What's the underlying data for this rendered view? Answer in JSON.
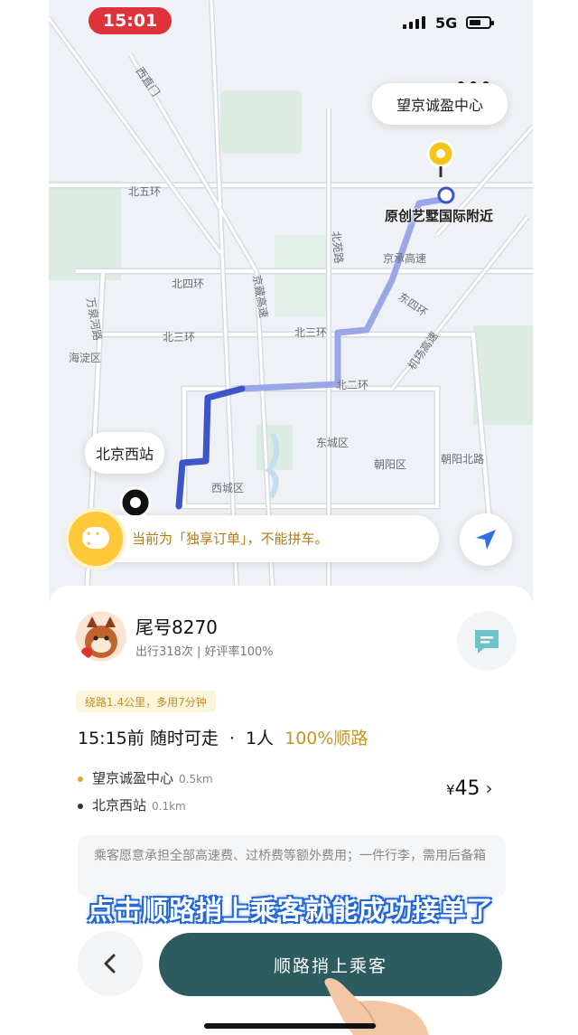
{
  "status_bar": {
    "time": "15:01",
    "network": "5G",
    "more": "•••"
  },
  "map": {
    "destination_label": "望京诚盈中心",
    "destination_sublabel": "原创艺墅国际附近",
    "origin_label": "北京西站",
    "road_labels": [
      "北五环",
      "北四环",
      "北三环",
      "北三环",
      "北二环",
      "东城区",
      "西城区",
      "朝阳区",
      "朝阳北路",
      "海淀区",
      "京藏高速",
      "万泉河路",
      "北苑路",
      "京承高速",
      "机场高速",
      "东四环",
      "西直门"
    ],
    "route_color": "#3d55c8"
  },
  "notice": {
    "text": "当前为「独享订单」，不能拼车。"
  },
  "icons": {
    "locate": "navigation-arrow-icon",
    "chat": "message-icon",
    "back": "chevron-left-icon",
    "notice": "chat-bubble-icon",
    "destination_pin": "yellow-pin-icon",
    "origin_pin": "black-pin-icon"
  },
  "driver": {
    "name": "尾号8270",
    "stats": "出行318次 | 好评率100%"
  },
  "trip": {
    "route_tag": "绕路1.4公里，多用7分钟",
    "depart": "15:15前",
    "availability": "随时可走",
    "separator": "·",
    "passengers": "1人",
    "match": "100%顺路",
    "stops": [
      {
        "name": "望京诚盈中心",
        "distance": "0.5km",
        "color": "#e0a82e"
      },
      {
        "name": "北京西站",
        "distance": "0.1km",
        "color": "#333333"
      }
    ],
    "price_symbol": "¥",
    "price": "45",
    "price_chevron": "›",
    "note": "乘客愿意承担全部高速费、过桥费等额外费用；一件行李，需用后备箱"
  },
  "overlay_caption": "点击顺路捎上乘客就能成功接单了",
  "actions": {
    "back_label": "‹",
    "primary_label": "顺路捎上乘客"
  },
  "colors": {
    "primary_button": "#2c5c60",
    "time_pill": "#e0323a",
    "accent_gold": "#c6961f",
    "caption_outline": "#2266d8"
  }
}
